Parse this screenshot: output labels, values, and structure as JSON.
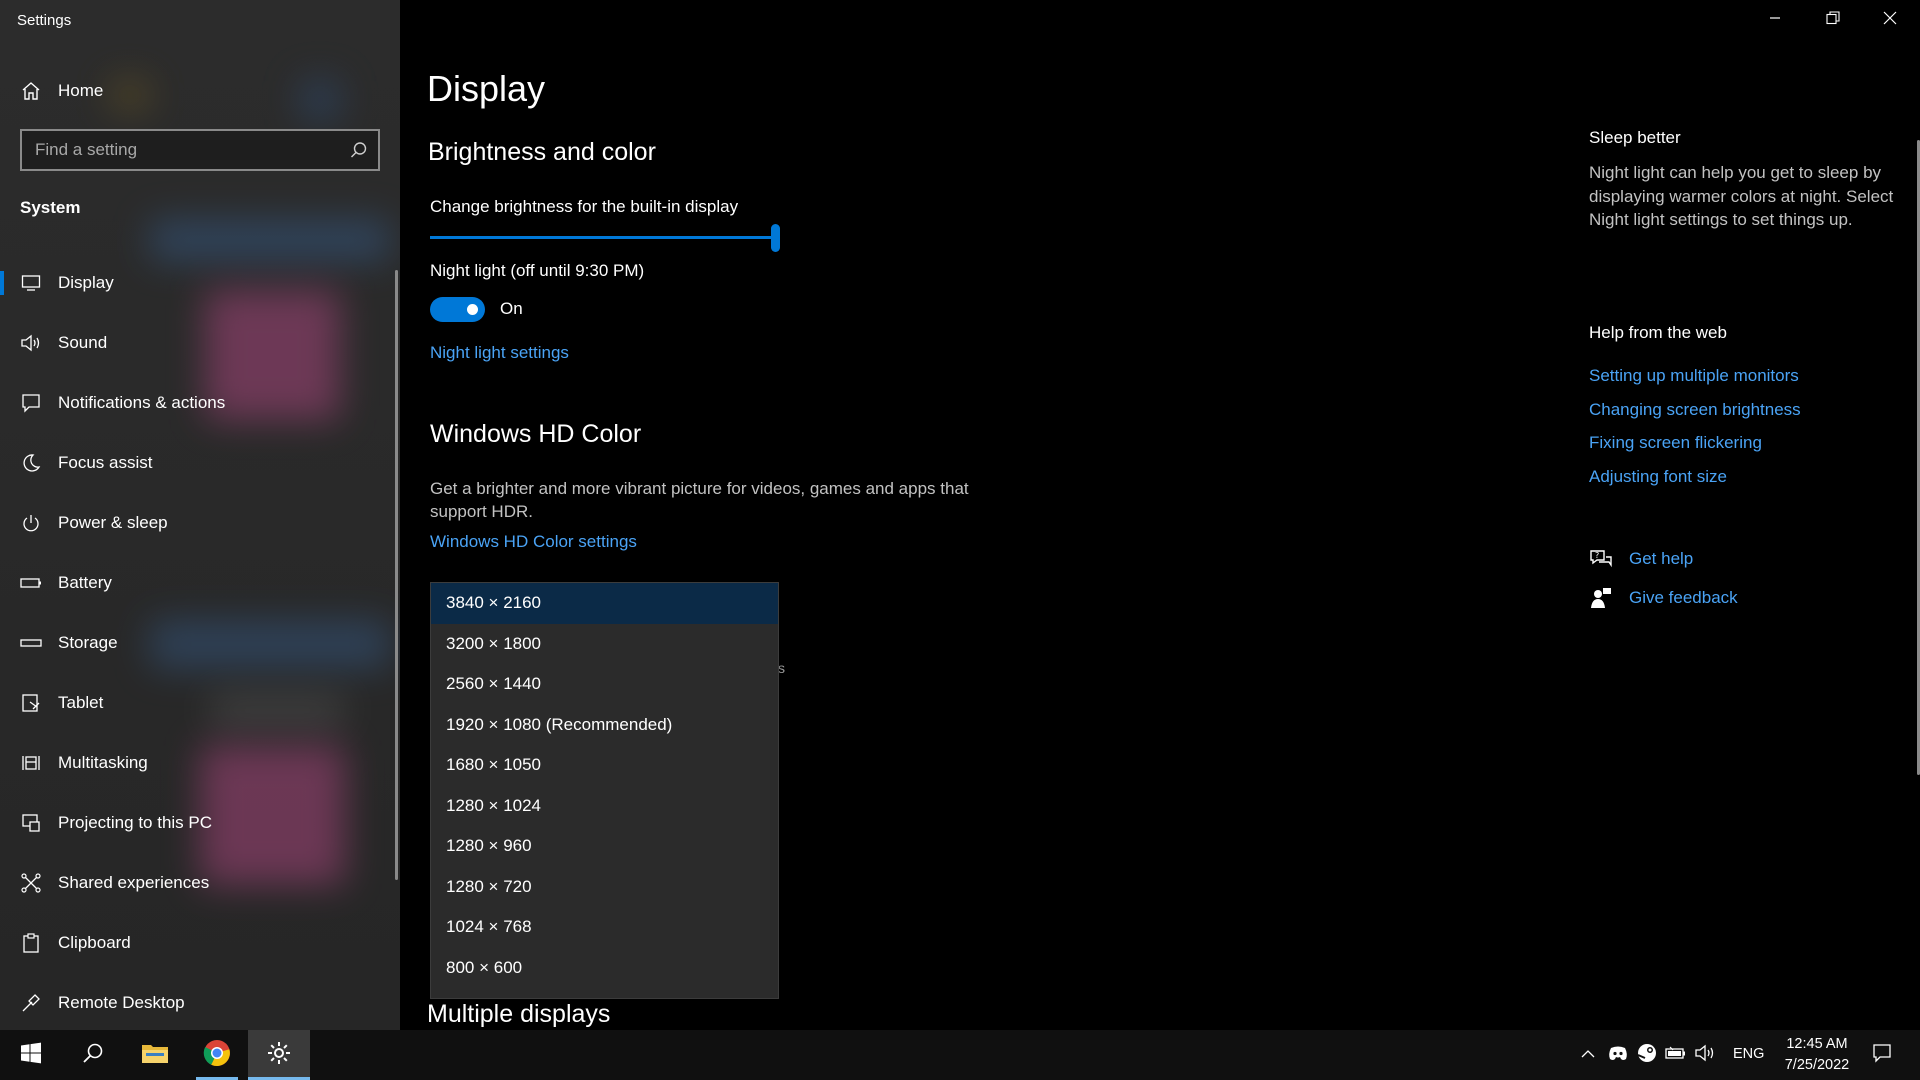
{
  "window": {
    "title": "Settings",
    "controls": [
      "minimize-icon",
      "restore-icon",
      "close-icon"
    ]
  },
  "sidebar": {
    "home_label": "Home",
    "search_placeholder": "Find a setting",
    "section_label": "System",
    "items": [
      {
        "label": "Display",
        "icon": "monitor-icon",
        "selected": true
      },
      {
        "label": "Sound",
        "icon": "speaker-icon"
      },
      {
        "label": "Notifications & actions",
        "icon": "notification-icon"
      },
      {
        "label": "Focus assist",
        "icon": "moon-icon"
      },
      {
        "label": "Power & sleep",
        "icon": "power-icon"
      },
      {
        "label": "Battery",
        "icon": "battery-icon"
      },
      {
        "label": "Storage",
        "icon": "storage-icon"
      },
      {
        "label": "Tablet",
        "icon": "tablet-icon"
      },
      {
        "label": "Multitasking",
        "icon": "multitasking-icon"
      },
      {
        "label": "Projecting to this PC",
        "icon": "projecting-icon"
      },
      {
        "label": "Shared experiences",
        "icon": "shared-icon"
      },
      {
        "label": "Clipboard",
        "icon": "clipboard-icon"
      },
      {
        "label": "Remote Desktop",
        "icon": "remote-desktop-icon"
      }
    ]
  },
  "main": {
    "title": "Display",
    "brightness": {
      "heading": "Brightness and color",
      "slider_label": "Change brightness for the built-in display",
      "level_percent": 100
    },
    "night_light": {
      "label": "Night light (off until 9:30 PM)",
      "toggle_state": "On",
      "settings_link": "Night light settings"
    },
    "hd_color": {
      "heading": "Windows HD Color",
      "description_line1": "Get a brighter and more vibrant picture for videos, games and apps that",
      "description_line2": "support HDR.",
      "settings_link": "Windows HD Color settings"
    },
    "resolution_dropdown": {
      "selected_index": 0,
      "options": [
        "3840 × 2160",
        "3200 × 1800",
        "2560 × 1440",
        "1920 × 1080 (Recommended)",
        "1680 × 1050",
        "1280 × 1024",
        "1280 × 960",
        "1280 × 720",
        "1024 × 768",
        "800 × 600"
      ],
      "peek_char": "s"
    },
    "multiple_displays_heading": "Multiple displays"
  },
  "related": {
    "sleep_heading": "Sleep better",
    "sleep_text": "Night light can help you get to sleep by displaying warmer colors at night. Select Night light settings to set things up.",
    "web_heading": "Help from the web",
    "web_links": [
      "Setting up multiple monitors",
      "Changing screen brightness",
      "Fixing screen flickering",
      "Adjusting font size"
    ],
    "get_help": "Get help",
    "give_feedback": "Give feedback"
  },
  "taskbar": {
    "apps": [
      "windows-start-icon",
      "search-icon",
      "file-explorer-icon",
      "chrome-icon",
      "settings-icon"
    ],
    "tray_icons": [
      "chevron-up-icon",
      "discord-icon",
      "steam-icon",
      "battery-icon",
      "volume-icon"
    ],
    "language": "ENG",
    "time": "12:45 AM",
    "date": "7/25/2022",
    "notifications_icon": "action-center-icon"
  },
  "colors": {
    "accent": "#0078d7",
    "link": "#4aa3f5",
    "sidebar_bg": "#2c2c2c",
    "main_bg": "#000000",
    "dropdown_selected": "#0b2a47"
  }
}
